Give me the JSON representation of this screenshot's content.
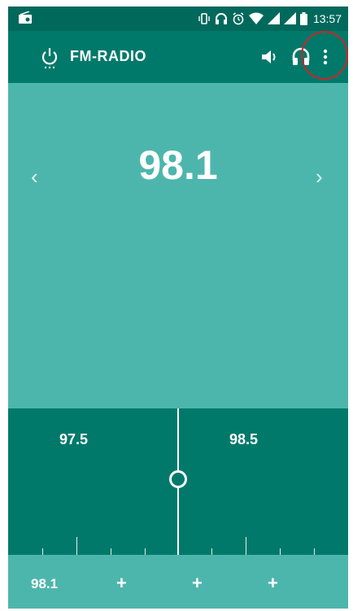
{
  "status_bar": {
    "time": "13:57",
    "icons": [
      "radio-icon",
      "vibrate-icon",
      "headphone-icon",
      "alarm-icon",
      "wifi-icon",
      "signal-icon",
      "signal-icon",
      "battery-icon"
    ]
  },
  "toolbar": {
    "title": "FM-RADIO",
    "icons": [
      "power-icon",
      "speaker-icon",
      "headset-icon",
      "overflow-menu-icon"
    ]
  },
  "station": {
    "frequency": "98.1",
    "prev_icon": "‹",
    "next_icon": "›"
  },
  "tuner": {
    "labels": [
      "97.5",
      "98.5"
    ]
  },
  "favorites": {
    "first": "98.1",
    "add_buttons": [
      "+",
      "+",
      "+"
    ]
  },
  "colors": {
    "status": "#00695c",
    "toolbar": "#00796b",
    "main": "#4db6ac",
    "annotation": "#c62828"
  }
}
